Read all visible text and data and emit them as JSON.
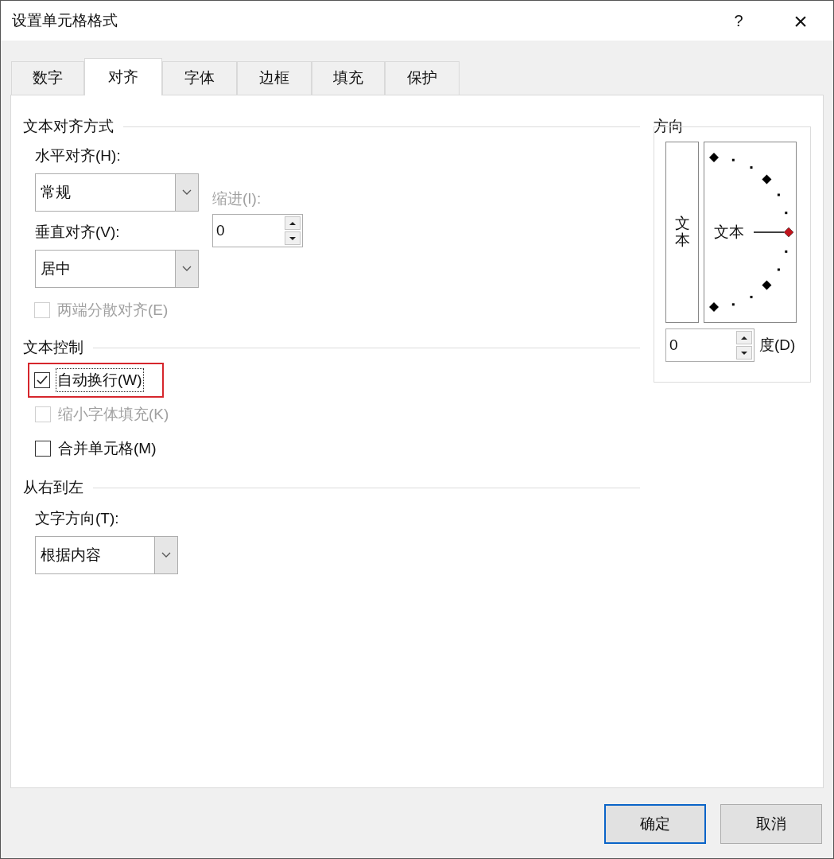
{
  "title_bar": {
    "title": "设置单元格格式",
    "help": "?",
    "close": "×"
  },
  "tabs": [
    {
      "label": "数字",
      "selected": false
    },
    {
      "label": "对齐",
      "selected": true
    },
    {
      "label": "字体",
      "selected": false
    },
    {
      "label": "边框",
      "selected": false
    },
    {
      "label": "填充",
      "selected": false
    },
    {
      "label": "保护",
      "selected": false
    }
  ],
  "text_alignment": {
    "title": "文本对齐方式",
    "horizontal": {
      "label": "水平对齐(H):",
      "value": "常规"
    },
    "indent": {
      "label": "缩进(I):",
      "value": "0",
      "disabled": true
    },
    "vertical": {
      "label": "垂直对齐(V):",
      "value": "居中"
    },
    "justify_distributed": {
      "label": "两端分散对齐(E)",
      "checked": false,
      "disabled": true
    }
  },
  "text_control": {
    "title": "文本控制",
    "options": [
      {
        "label": "自动换行(W)",
        "checked": true,
        "disabled": false,
        "focused": true,
        "highlighted": true
      },
      {
        "label": "缩小字体填充(K)",
        "checked": false,
        "disabled": true,
        "focused": false,
        "highlighted": false
      },
      {
        "label": "合并单元格(M)",
        "checked": false,
        "disabled": false,
        "focused": false,
        "highlighted": false
      }
    ]
  },
  "right_to_left": {
    "title": "从右到左",
    "direction": {
      "label": "文字方向(T):",
      "value": "根据内容"
    }
  },
  "orientation": {
    "title": "方向",
    "vertical_text": "文本",
    "dial_text": "文本",
    "degrees": {
      "value": "0",
      "label": "度(D)"
    }
  },
  "buttons": [
    {
      "label": "确定",
      "default": true
    },
    {
      "label": "取消",
      "default": false
    }
  ]
}
